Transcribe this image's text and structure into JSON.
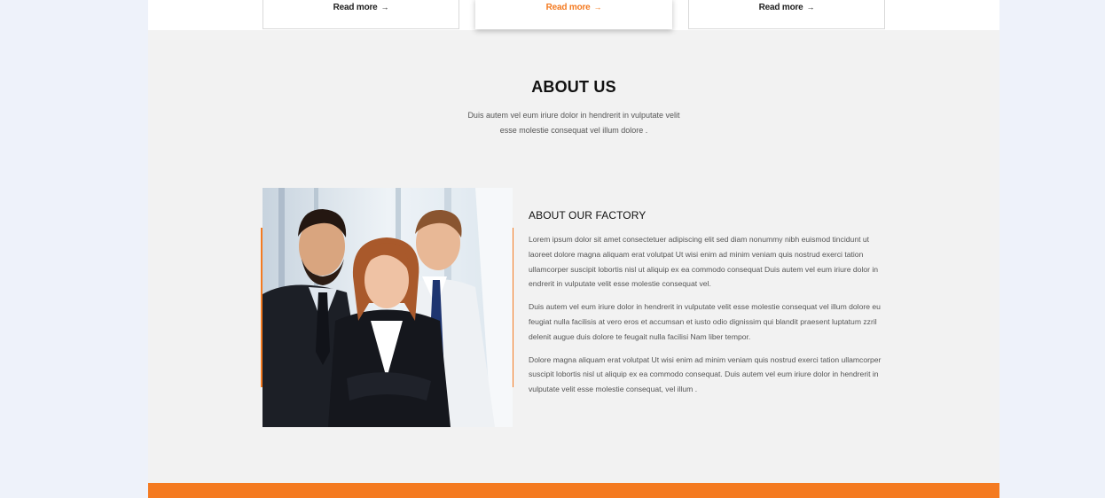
{
  "cards": [
    {
      "read_more": "Read more"
    },
    {
      "read_more": "Read more"
    },
    {
      "read_more": "Read more"
    }
  ],
  "about": {
    "title": "ABOUT US",
    "subtitle": "Duis autem vel eum iriure dolor in hendrerit in vulputate velit esse molestie consequat vel illum dolore ."
  },
  "factory": {
    "title": "ABOUT OUR FACTORY",
    "paragraphs": [
      "Lorem ipsum dolor sit amet consectetuer adipiscing elit sed diam nonummy nibh euismod tincidunt ut laoreet dolore magna aliquam erat volutpat Ut wisi enim ad minim veniam quis nostrud exerci tation ullamcorper suscipit lobortis nisl ut aliquip ex ea commodo consequat Duis autem vel eum iriure dolor in endrerit in vulputate velit esse molestie consequat vel.",
      "Duis autem vel eum iriure dolor in hendrerit in vulputate velit esse molestie consequat vel illum dolore eu feugiat nulla facilisis at vero eros et accumsan et iusto odio dignissim qui blandit praesent luptatum zzril delenit augue duis dolore te feugait nulla facilisi Nam liber tempor.",
      "Dolore magna aliquam erat volutpat Ut wisi enim ad minim veniam quis nostrud exerci tation ullamcorper suscipit lobortis nisl ut aliquip ex ea commodo consequat. Duis autem vel eum iriure dolor in hendrerit in vulputate velit esse molestie consequat, vel illum ."
    ]
  },
  "colors": {
    "accent": "#f47a20",
    "page_bg": "#eef2fa",
    "section_bg": "#f2f2f2"
  },
  "icons": {
    "read_more_arrow": "arrow-right-icon"
  }
}
